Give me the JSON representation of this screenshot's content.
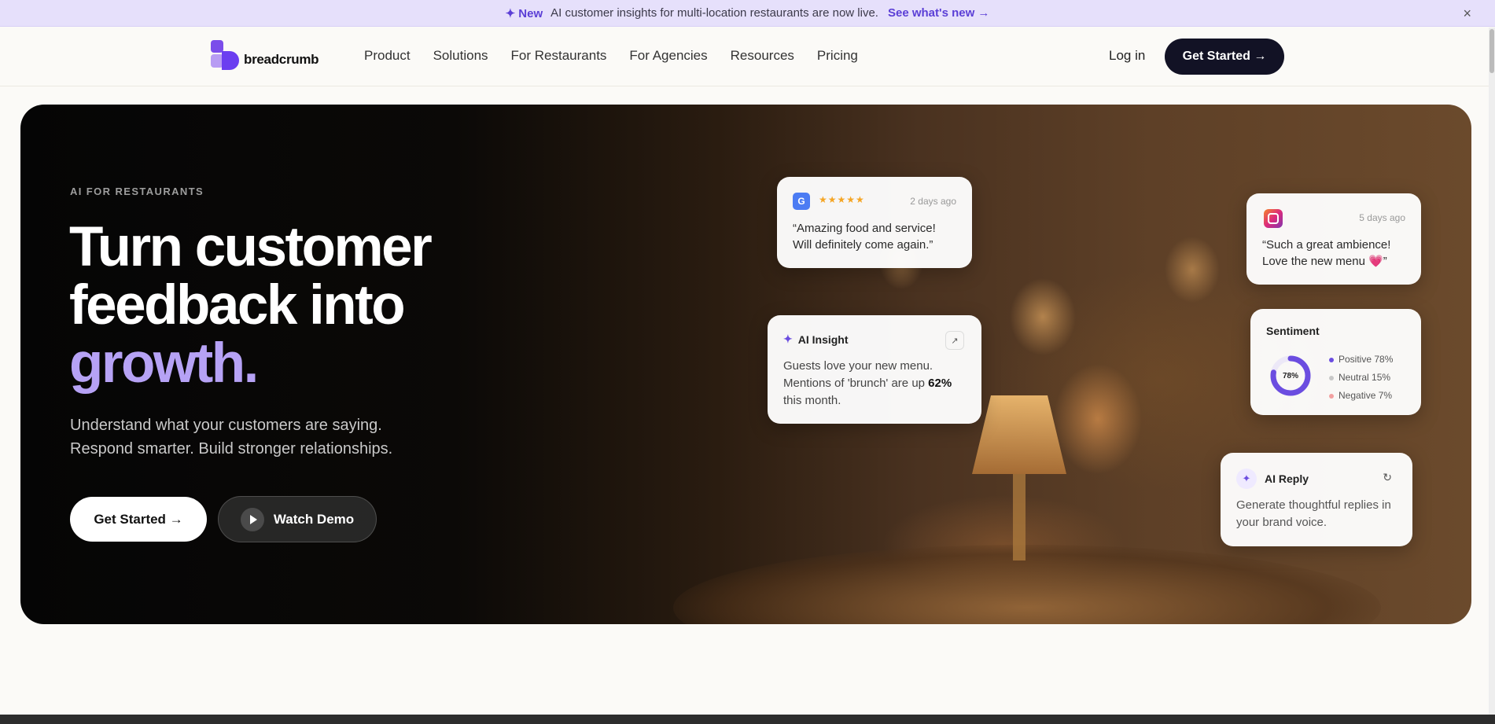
{
  "announcement": {
    "badge": "✦ New",
    "message": "AI customer insights for multi-location restaurants are now live.",
    "link": "See what's new →",
    "close": "×"
  },
  "nav": {
    "logo_text": "breadcrumb",
    "links": [
      "Product",
      "Solutions",
      "For Restaurants",
      "For Agencies",
      "Resources",
      "Pricing"
    ],
    "login": "Log in",
    "cta": "Get Started →"
  },
  "hero": {
    "eyebrow": "AI FOR RESTAURANTS",
    "headline_line1": "Turn customer",
    "headline_line2": "feedback into",
    "headline_accent": "growth.",
    "subtext_line1": "Understand what your customers are saying.",
    "subtext_line2": "Respond smarter. Build stronger relationships.",
    "primary_button": "Get Started →",
    "secondary_button": "Watch Demo"
  },
  "cards": {
    "google_review": {
      "badge": "G",
      "stars": "★★★★★",
      "time": "2 days ago",
      "line1": "“Amazing food and service!",
      "line2": "Will definitely come again.”"
    },
    "instagram_review": {
      "time": "5 days ago",
      "line1": "“Such a great ambience!",
      "line2": "Love the new menu 💗”"
    },
    "ai_insight": {
      "title": "AI Insight",
      "expand": "↗",
      "line1": "Guests love your new menu.",
      "line2_prefix": "Mentions of 'brunch' are up ",
      "line2_value": "62%",
      "line3": "this month."
    },
    "sentiment": {
      "title": "Sentiment",
      "center_label": "78%",
      "positive_fraction": 0.78,
      "items": [
        {
          "label": "Positive 78%",
          "color": "#6b4de0"
        },
        {
          "label": "Neutral 15%",
          "color": "#c8c8c8"
        },
        {
          "label": "Negative 7%",
          "color": "#f2a0a0"
        }
      ]
    },
    "ai_reply": {
      "icon": "✦",
      "title": "AI Reply",
      "refresh": "↻",
      "line1": "Generate thoughtful replies in",
      "line2": "your brand voice."
    }
  },
  "colors": {
    "accent": "#b6a2f5",
    "brand": "#6b3ef0",
    "announcement_bg": "#e6e0fb",
    "cta_dark": "#121225"
  }
}
